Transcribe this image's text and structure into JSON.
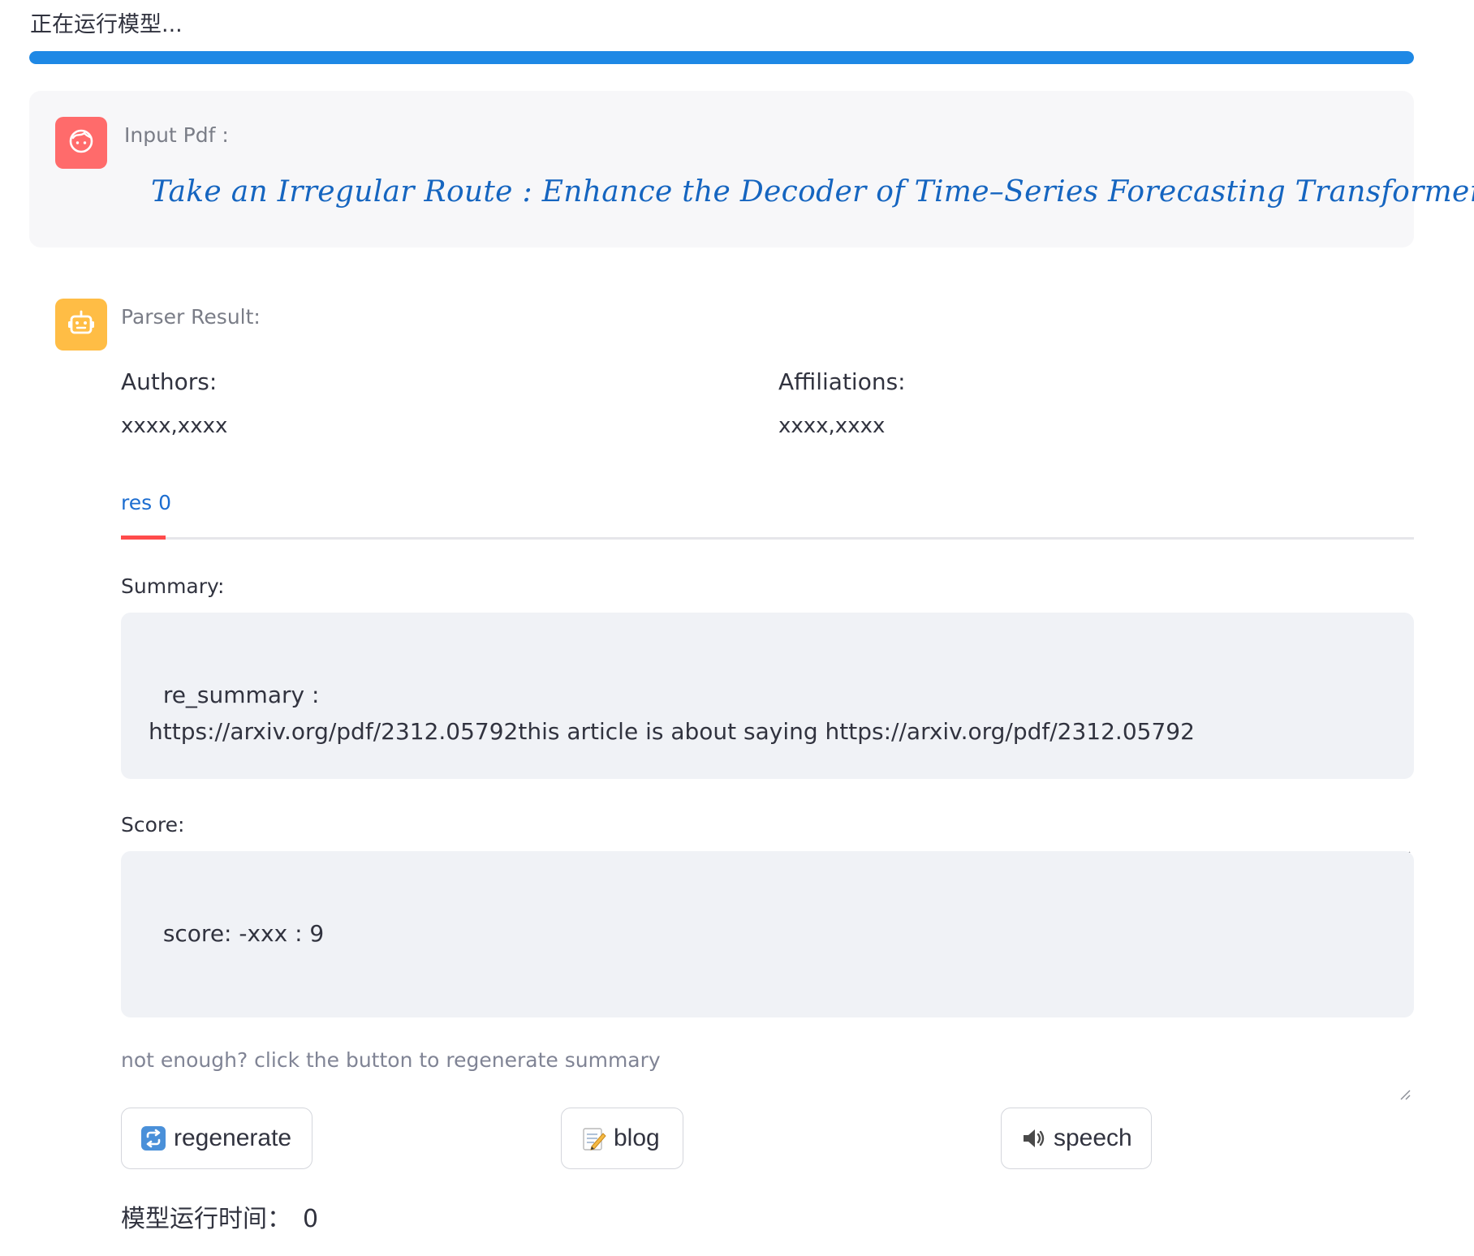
{
  "status": {
    "running_text": "正在运行模型...",
    "progress": 1.0,
    "accent": "#1e88e5"
  },
  "user_message": {
    "avatar_icon": "face-icon",
    "avatar_color": "#ff6b6b",
    "caption": "Input Pdf :",
    "paper_title": "Take an Irregular Route :  Enhance the Decoder of Time–Series Forecasting Transformer"
  },
  "bot_message": {
    "avatar_icon": "robot-icon",
    "avatar_color": "#ffbd45",
    "caption": "Parser Result:",
    "authors_label": "Authors:",
    "authors_value": "xxxx,xxxx",
    "affiliations_label": "Affiliations:",
    "affiliations_value": "xxxx,xxxx"
  },
  "tabs": [
    {
      "label": "res 0",
      "active": true
    }
  ],
  "summary": {
    "label": "Summary:",
    "value": "re_summary :\nhttps://arxiv.org/pdf/2312.05792this article is about saying https://arxiv.org/pdf/2312.05792"
  },
  "score": {
    "label": "Score:",
    "value": "score: -xxx : 9"
  },
  "hint_text": "not enough? click the button to regenerate summary",
  "buttons": {
    "regenerate": {
      "icon": "repeat-icon",
      "label": "regenerate"
    },
    "blog": {
      "icon": "memo-icon",
      "label": "blog"
    },
    "speech": {
      "icon": "speaker-icon",
      "label": "speech"
    }
  },
  "runtime": {
    "label": "模型运行时间：",
    "value": "0"
  }
}
